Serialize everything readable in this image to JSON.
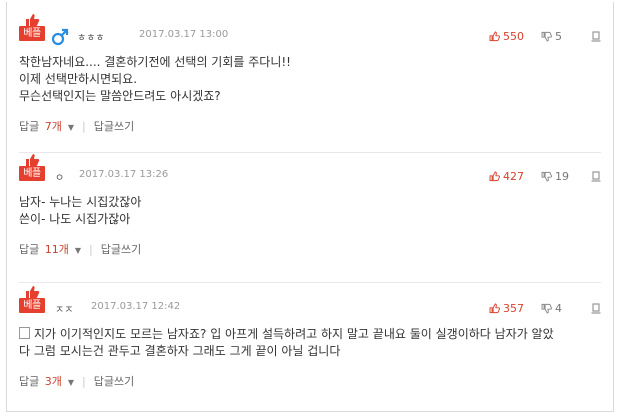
{
  "colors": {
    "accent": "#e5402f",
    "up": "#d9412f",
    "divider": "#e8e8e8"
  },
  "best_label": "베플",
  "comments": [
    {
      "nickname": "ㅎㅎㅎ",
      "date": "2017.03.17 13:00",
      "gender_icon": "male-icon",
      "up": "550",
      "down": "5",
      "lines": [
        "착한남자네요.... 결혼하기전에 선택의 기회를 주다니!!",
        "이제 선택만하시면되요.",
        "무슨선택인지는 말씀안드려도 아시겠죠?"
      ],
      "reply_label": "답글",
      "reply_count": "7개",
      "write_reply": "답글쓰기"
    },
    {
      "nickname": "ㅇ",
      "date": "2017.03.17 13:26",
      "up": "427",
      "down": "19",
      "lines": [
        "남자- 누나는 시집갔잖아",
        "쓴이- 나도 시집가잖아"
      ],
      "reply_label": "답글",
      "reply_count": "11개",
      "write_reply": "답글쓰기"
    },
    {
      "nickname": "ㅈㅈ",
      "date": "2017.03.17 12:42",
      "up": "357",
      "down": "4",
      "lines": [
        "지가 이기적인지도 모르는 남자죠? 입 아프게 설득하려고 하지 말고 끝내요 둘이 실갱이하다 남자가 알았",
        "다 그럼 모시는건 관두고 결혼하자 그래도 그게 끝이 아닐 겁니다"
      ],
      "reply_label": "답글",
      "reply_count": "3개",
      "write_reply": "답글쓰기"
    }
  ]
}
